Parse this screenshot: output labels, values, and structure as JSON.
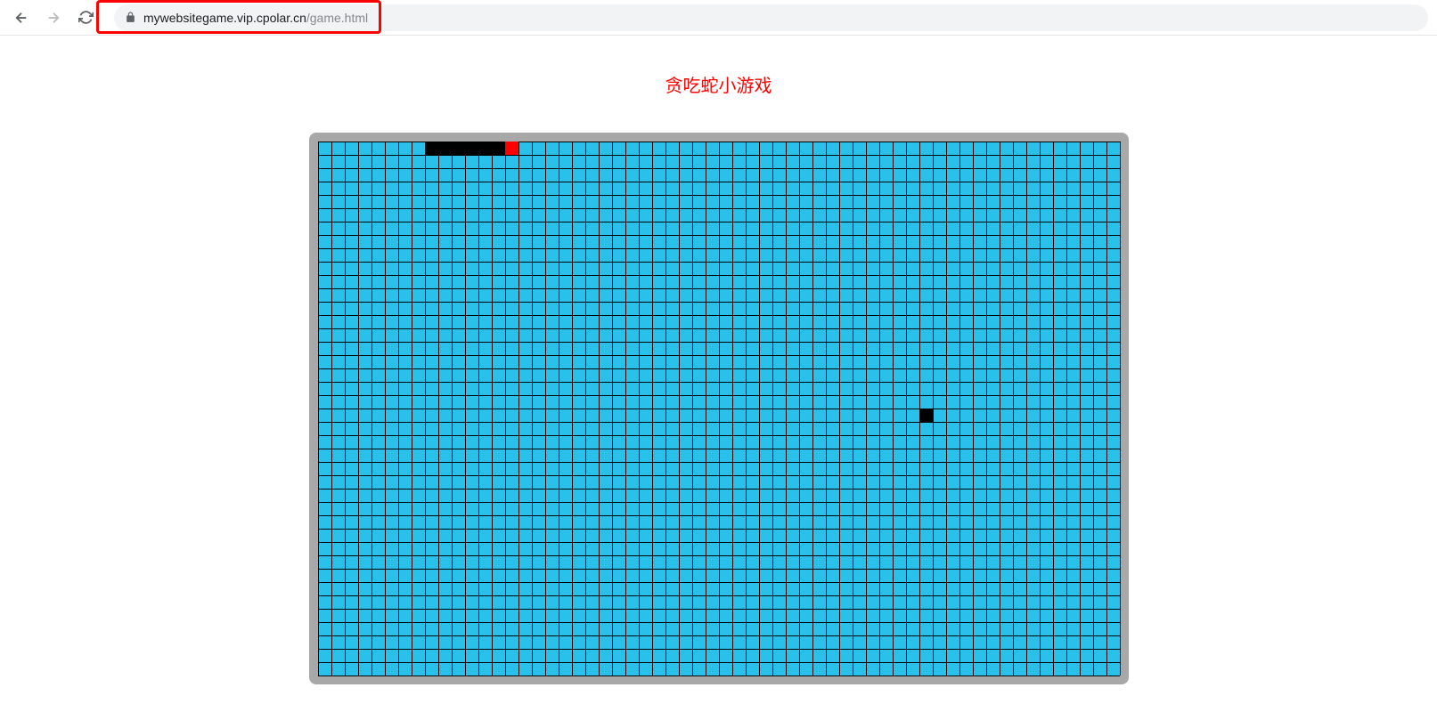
{
  "browser": {
    "url_domain": "mywebsitegame.vip.cpolar.cn",
    "url_path": "/game.html"
  },
  "game": {
    "title": "贪吃蛇小游戏",
    "board": {
      "cols": 60,
      "rows": 40,
      "cell_size": 15
    },
    "colors": {
      "board_bg": "#29c1ea",
      "frame": "#a8a8a8",
      "grid": "#000000",
      "snake_body": "#000000",
      "snake_head": "#ff0000",
      "food": "#000000",
      "title": "#ff0000"
    },
    "snake": {
      "body": [
        {
          "col": 8,
          "row": 0
        },
        {
          "col": 9,
          "row": 0
        },
        {
          "col": 10,
          "row": 0
        },
        {
          "col": 11,
          "row": 0
        },
        {
          "col": 12,
          "row": 0
        },
        {
          "col": 13,
          "row": 0
        }
      ],
      "head": {
        "col": 14,
        "row": 0
      }
    },
    "food": {
      "col": 45,
      "row": 20
    }
  }
}
